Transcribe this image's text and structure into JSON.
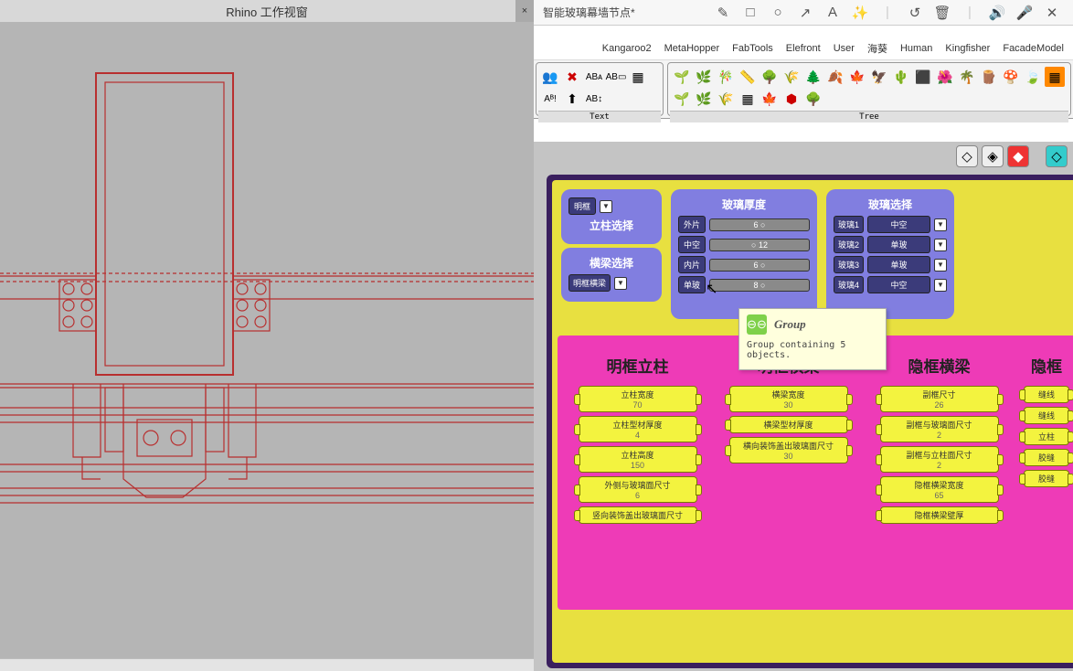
{
  "left": {
    "title": "Rhino 工作视窗",
    "close": "×"
  },
  "right": {
    "tab_name": "智能玻璃幕墙节点*",
    "top_icons": {
      "pencil": "✎",
      "square": "□",
      "circle": "○",
      "arrow": "↗",
      "a": "A",
      "magic": "✨",
      "undo": "↺",
      "trash": "🗑",
      "sound": "🔊",
      "mic": "🎤",
      "close": "✕"
    },
    "menu": [
      "Kangaroo2",
      "MetaHopper",
      "FabTools",
      "Elefront",
      "User",
      "海葵",
      "Human",
      "Kingfisher",
      "FacadeModel"
    ],
    "ribbon": {
      "text": {
        "label": "Text"
      },
      "tree": {
        "label": "Tree"
      }
    },
    "canvas": {
      "group_column_select": {
        "title1": "立柱选择",
        "val1": "明框",
        "title2": "横梁选择",
        "val2": "明框横梁"
      },
      "group_glass_thickness": {
        "title": "玻璃厚度",
        "rows": [
          {
            "name": "外片",
            "val": "6 ○"
          },
          {
            "name": "中空",
            "val": "○ 12"
          },
          {
            "name": "内片",
            "val": "6 ○"
          },
          {
            "name": "单玻",
            "val": "8 ○"
          }
        ]
      },
      "group_glass_select": {
        "title": "玻璃选择",
        "rows": [
          {
            "name": "玻璃1",
            "val": "中空"
          },
          {
            "name": "玻璃2",
            "val": "单玻"
          },
          {
            "name": "玻璃3",
            "val": "单玻"
          },
          {
            "name": "玻璃4",
            "val": "中空"
          }
        ]
      },
      "yellow_boxes": [
        {
          "title": "明框立柱",
          "params": [
            {
              "l": "立柱宽度",
              "v": "70"
            },
            {
              "l": "立柱型材厚度",
              "v": "4"
            },
            {
              "l": "立柱高度",
              "v": "150"
            },
            {
              "l": "外侧与玻璃面尺寸",
              "v": "6"
            },
            {
              "l": "竖向装饰盖出玻璃面尺寸",
              "v": ""
            }
          ]
        },
        {
          "title": "明框横梁",
          "params": [
            {
              "l": "横梁宽度",
              "v": "30"
            },
            {
              "l": "横梁型材厚度",
              "v": ""
            },
            {
              "l": "横向装饰盖出玻璃面尺寸",
              "v": "30"
            }
          ]
        },
        {
          "title": "隐框横梁",
          "params": [
            {
              "l": "副框尺寸",
              "v": "26"
            },
            {
              "l": "副框与玻璃面尺寸",
              "v": "2"
            },
            {
              "l": "副框与立柱面尺寸",
              "v": "2"
            },
            {
              "l": "隐框横梁宽度",
              "v": "65"
            },
            {
              "l": "隐框横梁壁厚",
              "v": ""
            }
          ]
        },
        {
          "title": "隐框",
          "params": [
            {
              "l": "缝线",
              "v": ""
            },
            {
              "l": "缝线",
              "v": ""
            },
            {
              "l": "立柱",
              "v": ""
            },
            {
              "l": "胶缝",
              "v": ""
            },
            {
              "l": "胶缝",
              "v": ""
            }
          ]
        }
      ]
    },
    "tooltip": {
      "title": "Group",
      "body": "Group containing 5 objects."
    }
  }
}
